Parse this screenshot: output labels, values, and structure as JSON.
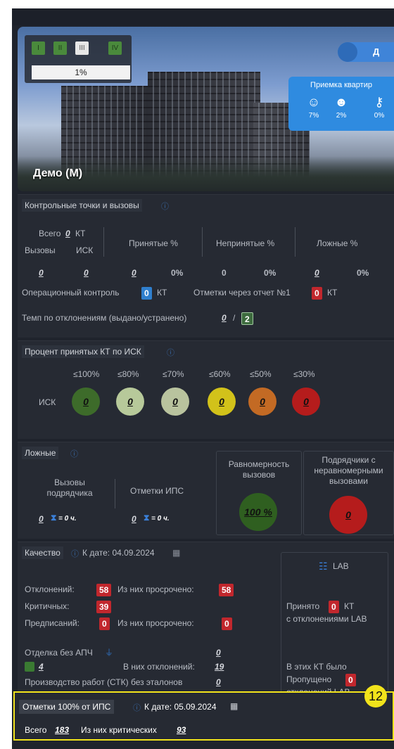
{
  "hero": {
    "project_title": "Демо (М)",
    "phases": [
      "I",
      "II",
      "III",
      "IV"
    ],
    "progress_label": "1%",
    "progress_value": 0.01,
    "toggle_label": "Д",
    "acceptance": {
      "title": "Приемка квартир",
      "items": [
        {
          "icon": "inspector-icon",
          "value": "7%"
        },
        {
          "icon": "worker-icon",
          "value": "2%"
        },
        {
          "icon": "keys-icon",
          "value": "0%"
        }
      ]
    }
  },
  "checkpoints": {
    "title": "Контрольные точки и вызовы",
    "total_label": "Всего",
    "total_value": "0",
    "kt_label": "КТ",
    "calls_label": "Вызовы",
    "isk_label": "ИСК",
    "accepted_label": "Принятые %",
    "rejected_label": "Непринятые %",
    "false_label": "Ложные %",
    "row": [
      "0",
      "0",
      "0",
      "0%",
      "0",
      "0%",
      "0",
      "0%"
    ],
    "op_control_label": "Операционный контроль",
    "op_control_value": "0",
    "op_control_unit": "КТ",
    "report_label": "Отметки через отчет №1",
    "report_value": "0",
    "report_unit": "КТ",
    "tempo_label": "Темп по отклонениям (выдано/устранено)",
    "tempo_issued": "0",
    "tempo_sep": "/",
    "tempo_fixed": "2"
  },
  "percent_accepted": {
    "title": "Процент принятых КТ по ИСК",
    "row_label": "ИСК",
    "thresholds": [
      "≤100%",
      "≤80%",
      "≤70%",
      "≤60%",
      "≤50%",
      "≤30%"
    ],
    "values": [
      "0",
      "0",
      "0",
      "0",
      "0",
      "0"
    ],
    "colors": [
      "#3d6b2a",
      "#b7c99a",
      "#b9c39e",
      "#d2c21a",
      "#c36a24",
      "#b51c1c"
    ]
  },
  "false_calls": {
    "title": "Ложные",
    "contractor_calls_label": "Вызовы подрядчика",
    "ips_marks_label": "Отметки ИПС",
    "contractor_calls_value": "0",
    "contractor_calls_time": "= 0 ч.",
    "ips_marks_value": "0",
    "ips_marks_time": "= 0 ч.",
    "uniformity_label": "Равномерность вызовов",
    "uniformity_value": "100 %",
    "uneven_label": "Подрядчики с неравномерными вызовами",
    "uneven_value": "0"
  },
  "quality": {
    "title": "Качество",
    "date_label": "К дате: 04.09.2024",
    "deviations_label": "Отклонений:",
    "deviations_value": "58",
    "overdue_label": "Из них просрочено:",
    "overdue_value": "58",
    "critical_label": "Критичных:",
    "critical_value": "39",
    "prescriptions_label": "Предписаний:",
    "prescriptions_value": "0",
    "prescriptions_overdue_label": "Из них просрочено:",
    "prescriptions_overdue_value": "0",
    "finish_label": "Отделка без АПЧ",
    "finish_value": "0",
    "finish_small_value": "4",
    "finish_deviation_label": "В них отклонений:",
    "finish_deviation_value": "19",
    "production_label": "Производство работ (СТК) без эталонов",
    "production_value": "0",
    "lab": {
      "title": "LAB",
      "accepted_label": "Принято",
      "accepted_value": "0",
      "accepted_unit": "КТ",
      "accepted_suffix": "с отклонениями LAB",
      "kt_label": "В этих КТ было",
      "missed_label": "Пропущено",
      "missed_value": "0",
      "missed_suffix": "отклонений LAB"
    }
  },
  "ips_marks": {
    "marker": "12",
    "title": "Отметки 100% от ИПС",
    "date_label": "К дате: 05.09.2024",
    "total_label": "Всего",
    "total_value": "183",
    "critical_label": "Из них критических",
    "critical_value": "93"
  }
}
